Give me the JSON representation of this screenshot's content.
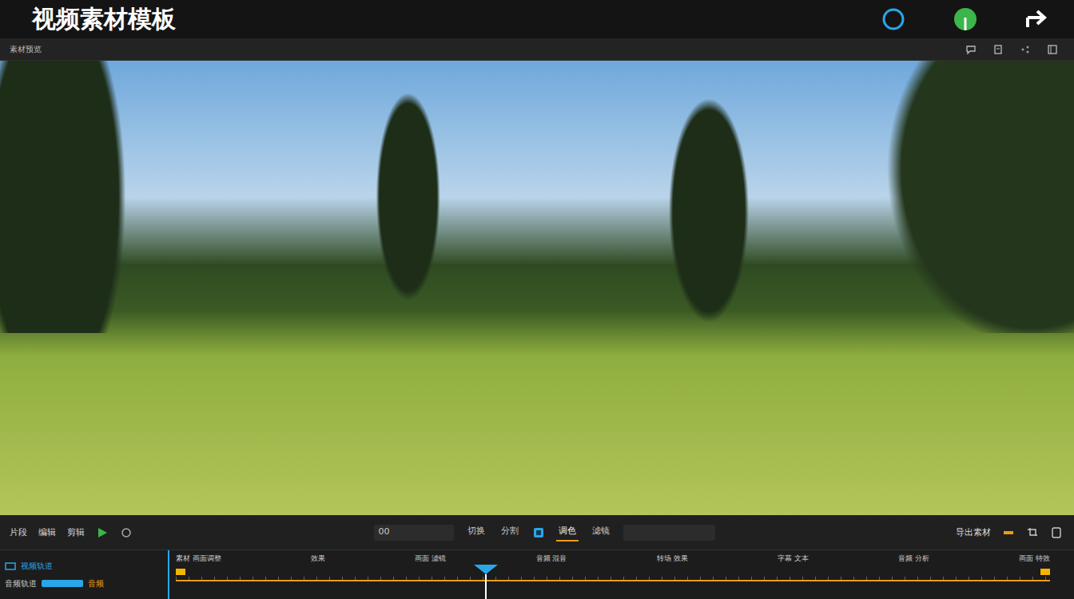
{
  "window": {
    "title": "视频素材模板"
  },
  "preview_bar": {
    "label": "素材预览"
  },
  "controls": {
    "left": [
      "片段",
      "编辑",
      "剪辑"
    ],
    "time_field": "00",
    "tools": [
      {
        "label": "切换",
        "selected": false
      },
      {
        "label": "分割",
        "selected": false
      },
      {
        "label": "调色",
        "selected": true
      },
      {
        "label": "滤镜",
        "selected": false
      }
    ],
    "export": "导出素材"
  },
  "timeline": {
    "tracks": [
      {
        "label": "视频轨道",
        "selected": true
      },
      {
        "label": "音频轨道",
        "selected": false
      }
    ],
    "clip": {
      "label": "音频"
    },
    "ruler_labels": [
      "素材 画面调整",
      "效果",
      "画面 滤镜",
      "音频 混音",
      "转场 效果",
      "字幕 文本",
      "音频 分析",
      "画面 特效"
    ],
    "playhead": {
      "level": 0.35
    }
  }
}
